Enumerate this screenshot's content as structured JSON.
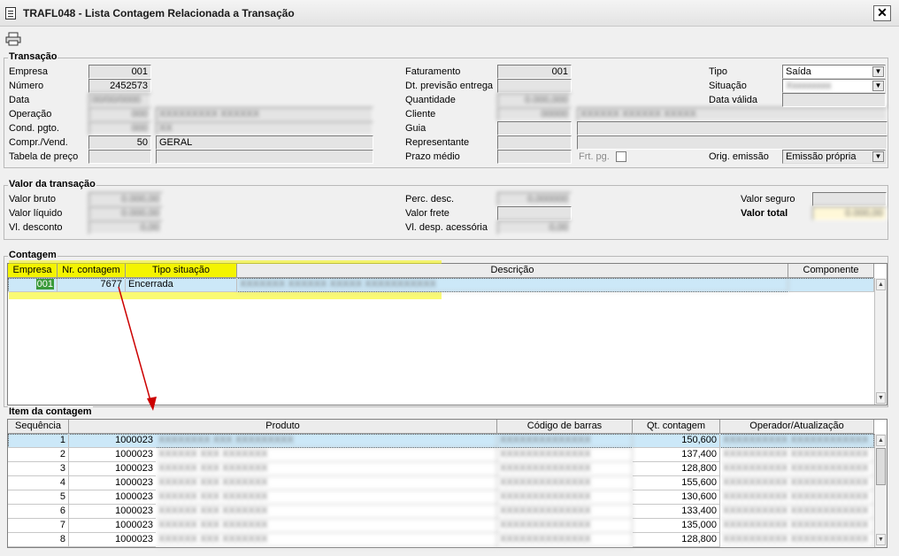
{
  "window": {
    "title": "TRAFL048 - Lista Contagem Relacionada a Transação",
    "close_label": "✕"
  },
  "toolbar": {
    "print_icon": "printer-icon"
  },
  "transacao": {
    "title": "Transação",
    "empresa_label": "Empresa",
    "empresa": "001",
    "numero_label": "Número",
    "numero": "2452573",
    "data_label": "Data",
    "data": "00/00/0000",
    "operacao_label": "Operação",
    "operacao_code": "000",
    "operacao_desc": "XXXXXXXXX XXXXXX",
    "cond_label": "Cond. pgto.",
    "cond_code": "000",
    "cond_desc": "XX",
    "compr_label": "Compr./Vend.",
    "compr_code": "50",
    "compr_desc": "GERAL",
    "tabela_label": "Tabela de preço",
    "faturamento_label": "Faturamento",
    "faturamento": "001",
    "dt_prev_label": "Dt. previsão entrega",
    "quantidade_label": "Quantidade",
    "quantidade": "0.000,000",
    "cliente_label": "Cliente",
    "cliente_code": "00000",
    "cliente_name": "XXXXXX XXXXXX XXXXX",
    "guia_label": "Guia",
    "representante_label": "Representante",
    "prazo_label": "Prazo médio",
    "frt_label": "Frt. pg.",
    "tipo_label": "Tipo",
    "tipo": "Saída",
    "situacao_label": "Situação",
    "situacao": "Xxxxxxxxx",
    "data_valida_label": "Data válida",
    "orig_label": "Orig. emissão",
    "orig": "Emissão própria"
  },
  "valor": {
    "title": "Valor da transação",
    "bruto_label": "Valor bruto",
    "bruto": "0.000,00",
    "liquido_label": "Valor líquido",
    "liquido": "0.000,00",
    "desconto_label": "Vl. desconto",
    "desconto": "0,00",
    "perc_label": "Perc. desc.",
    "perc": "0,000000",
    "frete_label": "Valor frete",
    "desp_label": "Vl. desp. acessória",
    "desp": "0,00",
    "seguro_label": "Valor seguro",
    "total_label": "Valor total",
    "total": "0.000,00"
  },
  "contagem": {
    "title": "Contagem",
    "headers": [
      "Empresa",
      "Nr. contagem",
      "Tipo situação",
      "Descrição",
      "Componente"
    ],
    "rows": [
      {
        "empresa": "001",
        "nr": "7677",
        "tipo": "Encerrada",
        "descricao": "XXXXXXX XXXXXX XXXXX XXXXXXXXXXX",
        "componente": ""
      }
    ]
  },
  "itens": {
    "title": "Item da contagem",
    "headers": [
      "Sequência",
      "Produto",
      "Código de barras",
      "Qt. contagem",
      "Operador/Atualização"
    ],
    "rows": [
      {
        "seq": "1",
        "codigo": "1000023",
        "produto": "XXXXXXXX XXX XXXXXXXXX",
        "barras": "XXXXXXXXXXXXXX",
        "qt": "150,600",
        "operador": "XXXXXXXXXX XXXXXXXXXXXX"
      },
      {
        "seq": "2",
        "codigo": "1000023",
        "produto": "XXXXXX XXX XXXXXXX",
        "barras": "XXXXXXXXXXXXXX",
        "qt": "137,400",
        "operador": "XXXXXXXXXX XXXXXXXXXXXX"
      },
      {
        "seq": "3",
        "codigo": "1000023",
        "produto": "XXXXXX XXX XXXXXXX",
        "barras": "XXXXXXXXXXXXXX",
        "qt": "128,800",
        "operador": "XXXXXXXXXX XXXXXXXXXXXX"
      },
      {
        "seq": "4",
        "codigo": "1000023",
        "produto": "XXXXXX XXX XXXXXXX",
        "barras": "XXXXXXXXXXXXXX",
        "qt": "155,600",
        "operador": "XXXXXXXXXX XXXXXXXXXXXX"
      },
      {
        "seq": "5",
        "codigo": "1000023",
        "produto": "XXXXXX XXX XXXXXXX",
        "barras": "XXXXXXXXXXXXXX",
        "qt": "130,600",
        "operador": "XXXXXXXXXX XXXXXXXXXXXX"
      },
      {
        "seq": "6",
        "codigo": "1000023",
        "produto": "XXXXXX XXX XXXXXXX",
        "barras": "XXXXXXXXXXXXXX",
        "qt": "133,400",
        "operador": "XXXXXXXXXX XXXXXXXXXXXX"
      },
      {
        "seq": "7",
        "codigo": "1000023",
        "produto": "XXXXXX XXX XXXXXXX",
        "barras": "XXXXXXXXXXXXXX",
        "qt": "135,000",
        "operador": "XXXXXXXXXX XXXXXXXXXXXX"
      },
      {
        "seq": "8",
        "codigo": "1000023",
        "produto": "XXXXXX XXX XXXXXXX",
        "barras": "XXXXXXXXXXXXXX",
        "qt": "128,800",
        "operador": "XXXXXXXXXX XXXXXXXXXXXX"
      }
    ]
  },
  "colors": {
    "highlight": "#f4f400",
    "selected_row": "#cce8f8",
    "arrow": "#cc0000",
    "panel": "#f0f0f0"
  }
}
